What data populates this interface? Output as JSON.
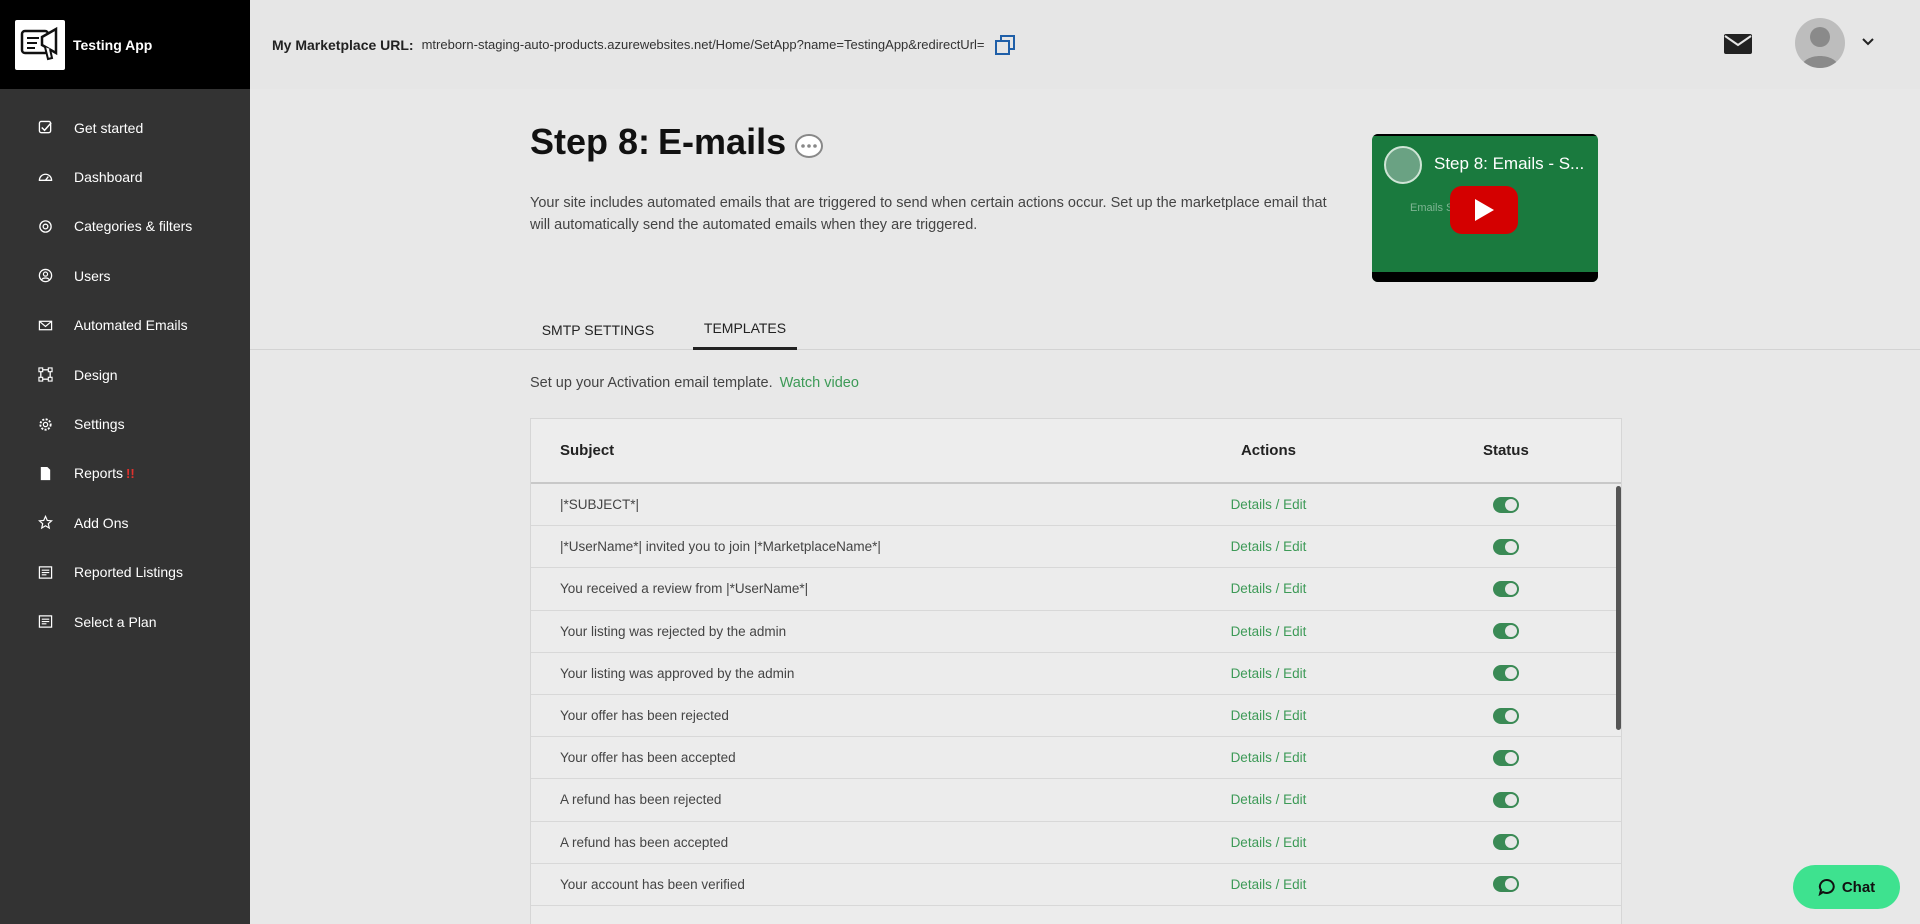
{
  "app": {
    "name": "Testing App"
  },
  "header": {
    "url_label": "My Marketplace URL:",
    "url_value": "mtreborn-staging-auto-products.azurewebsites.net/Home/SetApp?name=TestingApp&redirectUrl="
  },
  "sidebar": {
    "items": [
      {
        "label": "Get started",
        "icon": "checkbox-icon"
      },
      {
        "label": "Dashboard",
        "icon": "gauge-icon"
      },
      {
        "label": "Categories & filters",
        "icon": "target-icon"
      },
      {
        "label": "Users",
        "icon": "user-circle-icon"
      },
      {
        "label": "Automated Emails",
        "icon": "envelope-icon"
      },
      {
        "label": "Design",
        "icon": "design-frame-icon"
      },
      {
        "label": "Settings",
        "icon": "gear-icon"
      },
      {
        "label": "Reports",
        "icon": "document-icon",
        "badge": "!!"
      },
      {
        "label": "Add Ons",
        "icon": "star-icon"
      },
      {
        "label": "Reported Listings",
        "icon": "list-icon"
      },
      {
        "label": "Select a Plan",
        "icon": "list-icon"
      }
    ]
  },
  "page": {
    "step": "Step 8:",
    "title": "E-mails",
    "intro": "Your site includes automated emails that are triggered to send when certain actions occur. Set up the marketplace email that will automatically send the automated emails when they are triggered.",
    "video": {
      "title": "Step 8: Emails - S...",
      "subtitle": "Emails Settings"
    },
    "tabs": [
      {
        "label": "SMTP SETTINGS"
      },
      {
        "label": "TEMPLATES",
        "active": true
      }
    ],
    "setup_text": "Set up your Activation email template.",
    "watch_video": "Watch video"
  },
  "table": {
    "headers": {
      "subject": "Subject",
      "actions": "Actions",
      "status": "Status"
    },
    "rows": [
      {
        "subject": "|*SUBJECT*|",
        "action": "Details / Edit",
        "status": "on"
      },
      {
        "subject": "|*UserName*| invited you to join |*MarketplaceName*|",
        "action": "Details / Edit",
        "status": "on"
      },
      {
        "subject": "You received a review from |*UserName*|",
        "action": "Details / Edit",
        "status": "on"
      },
      {
        "subject": "Your listing was rejected by the admin",
        "action": "Details / Edit",
        "status": "on"
      },
      {
        "subject": "Your listing was approved by the admin",
        "action": "Details / Edit",
        "status": "on"
      },
      {
        "subject": "Your offer has been rejected",
        "action": "Details / Edit",
        "status": "on"
      },
      {
        "subject": "Your offer has been accepted",
        "action": "Details / Edit",
        "status": "on"
      },
      {
        "subject": "A refund has been rejected",
        "action": "Details / Edit",
        "status": "on"
      },
      {
        "subject": "A refund has been accepted",
        "action": "Details / Edit",
        "status": "on"
      },
      {
        "subject": "Your account has been verified",
        "action": "Details / Edit",
        "status": "on"
      }
    ]
  },
  "chat": {
    "label": "Chat"
  },
  "colors": {
    "sidebar": "#333333",
    "accent": "#3d9a57",
    "chat": "#3ee28f",
    "badge": "#e0312d"
  }
}
